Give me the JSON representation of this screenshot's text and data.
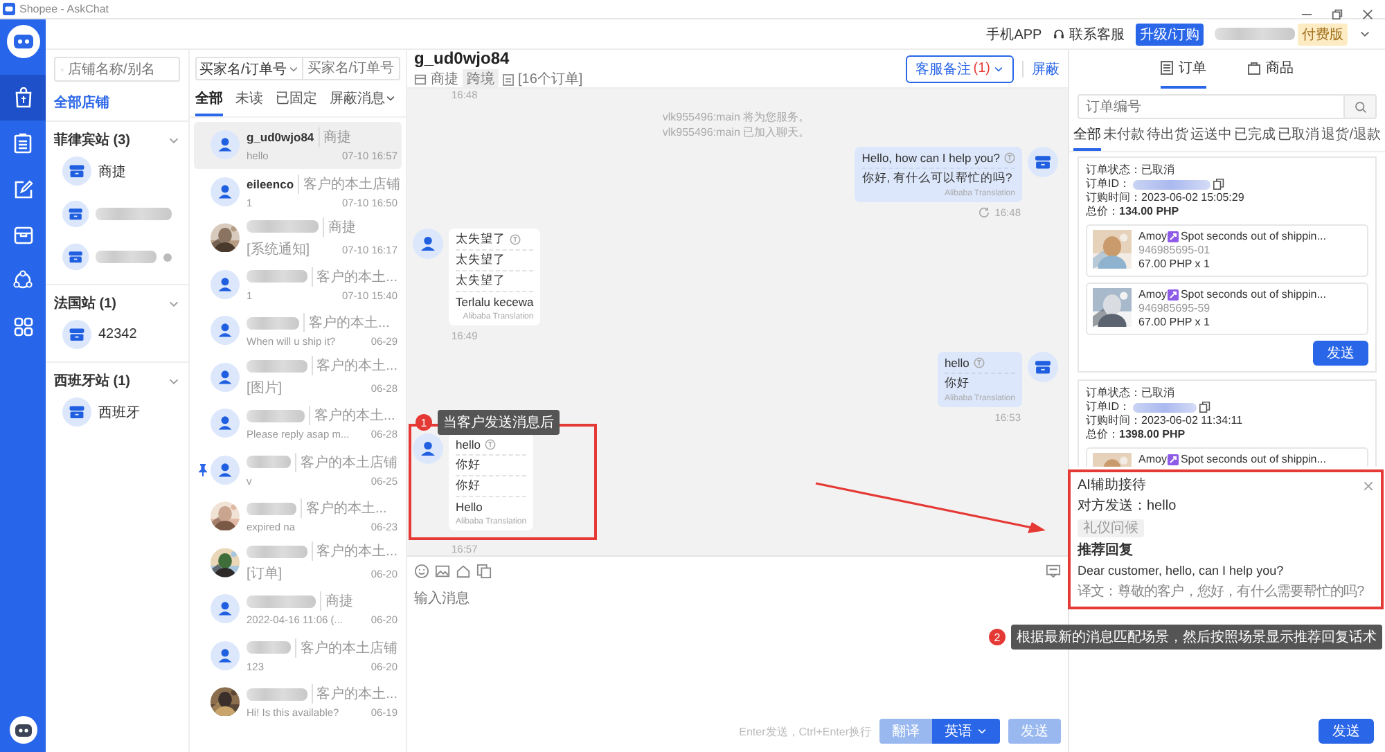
{
  "window": {
    "title": "Shopee - AskChat"
  },
  "header": {
    "links": [
      {
        "kind": "phone",
        "label": "手机APP"
      },
      {
        "kind": "support",
        "label": "联系客服"
      }
    ],
    "upgrade": "升级/订购",
    "plan": "付费版"
  },
  "nav": [
    {
      "kind": "shop",
      "selected": true
    },
    {
      "kind": "orders",
      "selected": false
    },
    {
      "kind": "edit",
      "selected": false
    },
    {
      "kind": "store",
      "selected": false
    },
    {
      "kind": "network",
      "selected": false
    },
    {
      "kind": "apps",
      "selected": false
    }
  ],
  "stores": {
    "placeholder": "店铺名称/别名",
    "all_link": "全部店铺",
    "groups": [
      {
        "name": "菲律宾站 (3)",
        "expanded": true,
        "items": [
          {
            "name": "商捷",
            "status_dot": false
          },
          {
            "status_dot": false
          },
          {
            "status_dot": true
          }
        ]
      },
      {
        "name": "法国站 (1)",
        "expanded": true,
        "items": [
          {
            "name": "42342",
            "status_dot": false
          }
        ]
      },
      {
        "name": "西班牙站 (1)",
        "expanded": true,
        "items": [
          {
            "name": "西班牙",
            "status_dot": false
          }
        ]
      }
    ]
  },
  "conversations": {
    "search_type": "买家名/订单号",
    "placeholder": "买家名/订单号",
    "tabs": [
      {
        "label": "全部",
        "selected": true
      },
      {
        "label": "未读",
        "selected": false
      },
      {
        "label": "已固定",
        "selected": false
      },
      {
        "label": "屏蔽消息",
        "selected": false,
        "kind": "dropdown"
      }
    ],
    "items": [
      {
        "name": "g_ud0wjo84",
        "shop": "商捷",
        "preview": "hello",
        "time": "07-10 16:57",
        "kind": "person",
        "pinned": false,
        "selected": true
      },
      {
        "name": "eileenco",
        "shop": "客户的本土店铺",
        "preview": "1",
        "time": "07-10 16:50",
        "kind": "person",
        "pinned": false,
        "selected": false
      },
      {
        "shop": "商捷",
        "preview": "[系统通知]",
        "time": "07-10 16:17",
        "pinned": false,
        "selected": false
      },
      {
        "shop": "客户的本土...",
        "preview": "1",
        "time": "07-10 15:40",
        "kind": "person",
        "pinned": false,
        "selected": false
      },
      {
        "shop": "客户的本土...",
        "preview": "When will u ship it?",
        "time": "06-29",
        "kind": "person",
        "pinned": false,
        "selected": false
      },
      {
        "shop": "客户的本土...",
        "preview": "[图片]",
        "time": "06-28",
        "kind": "person",
        "pinned": false,
        "selected": false
      },
      {
        "shop": "客户的本土...",
        "preview": "Please reply asap m...",
        "time": "06-28",
        "kind": "person",
        "pinned": false,
        "selected": false
      },
      {
        "shop": "客户的本土店铺",
        "preview": "v",
        "time": "06-25",
        "kind": "person",
        "pinned": true,
        "selected": false
      },
      {
        "shop": "客户的本土...",
        "preview": "expired na",
        "time": "06-23",
        "pinned": false,
        "selected": false
      },
      {
        "shop": "客户的本土...",
        "preview": "[订单]",
        "time": "06-20",
        "pinned": false,
        "selected": false
      },
      {
        "shop": "商捷",
        "preview": "2022-04-16 11:06 (...",
        "time": "06-20",
        "kind": "person",
        "pinned": false,
        "selected": false
      },
      {
        "shop": "客户的本土店铺",
        "preview": "123",
        "time": "06-20",
        "kind": "person",
        "pinned": false,
        "selected": false
      },
      {
        "shop": "客户的本土...",
        "preview": "Hi! Is this available?",
        "time": "06-19",
        "pinned": false,
        "selected": false
      }
    ]
  },
  "chat": {
    "title": "g_ud0wjo84",
    "shop": "商捷",
    "tag": "跨境",
    "orders": "[16个订单]",
    "note_button": "客服备注",
    "note_count": "(1)",
    "block": "屏蔽",
    "messages": [
      {
        "kind": "time",
        "text": "16:48"
      },
      {
        "kind": "system",
        "lines": [
          "vlk955496:main 将为您服务。",
          "vlk955496:main 已加入聊天。"
        ]
      },
      {
        "kind": "out",
        "lines": [
          "Hello, how can I help you?",
          "你好, 有什么可以帮忙的吗?"
        ],
        "source": "Alibaba Translation",
        "time": "16:48",
        "read": true,
        "highlighted": false
      },
      {
        "kind": "in",
        "lines": [
          "太失望了",
          "太失望了",
          "太失望了",
          "Terlalu kecewa"
        ],
        "source": "Alibaba Translation",
        "time": "16:49",
        "highlighted": false
      },
      {
        "kind": "out",
        "lines": [
          "hello",
          "你好"
        ],
        "source": "Alibaba Translation",
        "time": "16:53",
        "read": false,
        "highlighted": false
      },
      {
        "kind": "in",
        "lines": [
          "hello",
          "你好",
          "你好",
          "Hello"
        ],
        "source": "Alibaba Translation",
        "time": "16:57",
        "highlighted": true
      }
    ],
    "input": {
      "placeholder": "输入消息",
      "hint": "Enter发送，Ctrl+Enter换行",
      "translate": "翻译",
      "translate_disabled": true,
      "language": "英语",
      "send": "发送",
      "send_disabled": true
    }
  },
  "orders_panel": {
    "tabs": [
      {
        "kind": "orders",
        "label": "订单",
        "selected": true
      },
      {
        "kind": "products",
        "label": "商品",
        "selected": false
      }
    ],
    "placeholder": "订单编号",
    "filters": [
      {
        "label": "全部",
        "selected": true
      },
      {
        "label": "未付款",
        "selected": false
      },
      {
        "label": "待出货",
        "selected": false
      },
      {
        "label": "运送中",
        "selected": false
      },
      {
        "label": "已完成",
        "selected": false
      },
      {
        "label": "已取消",
        "selected": false
      },
      {
        "label": "退货/退款",
        "selected": false
      }
    ],
    "orders": [
      {
        "status": "订单状态：已取消",
        "id_label": "订单ID：",
        "time": "订购时间：2023-06-02 15:05:29",
        "total": "总价：**134.00 PHP**",
        "items": [
          {
            "prefix": "Amoy",
            "title": "Spot seconds out of shippin...",
            "sku": "946985695-01",
            "price": "67.00 PHP x 1"
          },
          {
            "prefix": "Amoy",
            "title": "Spot seconds out of shippin...",
            "sku": "946985695-59",
            "price": "67.00 PHP x 1"
          }
        ],
        "send": "发送"
      },
      {
        "status": "订单状态：已取消",
        "id_label": "订单ID：",
        "time": "订购时间：2023-06-02 11:34:11",
        "total": "总价：**1398.00 PHP**",
        "items": [
          {
            "prefix": "Amoy",
            "title": "Spot seconds out of shippin..."
          }
        ]
      }
    ],
    "send": "发送"
  },
  "ai_popup": {
    "title": "AI辅助接待",
    "received": "对方发送：hello",
    "scene": "礼仪问候",
    "recommend_label": "推荐回复",
    "reply": "Dear customer, hello, can I help you?",
    "translation": "译文：尊敬的客户，您好，有什么需要帮忙的吗?"
  },
  "annotations": [
    {
      "number": "1",
      "text": "当客户发送消息后"
    },
    {
      "number": "2",
      "text": "根据最新的消息匹配场景，然后按照场景显示推荐回复话术"
    }
  ]
}
